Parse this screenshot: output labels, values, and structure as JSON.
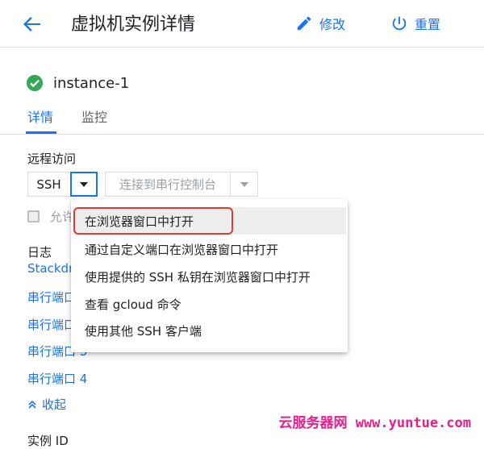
{
  "header": {
    "title": "虚拟机实例详情",
    "edit_label": "修改",
    "reset_label": "重置"
  },
  "instance": {
    "name": "instance-1",
    "status": "running"
  },
  "tabs": [
    {
      "label": "详情",
      "active": true
    },
    {
      "label": "监控",
      "active": false
    }
  ],
  "remote_access": {
    "label": "远程访问",
    "ssh_label": "SSH",
    "serial_label": "连接到串行控制台",
    "checkbox_label": "允许"
  },
  "ssh_menu": {
    "items": [
      "在浏览器窗口中打开",
      "通过自定义端口在浏览器窗口中打开",
      "使用提供的 SSH 私钥在浏览器窗口中打开",
      "查看 gcloud 命令",
      "使用其他 SSH 客户端"
    ]
  },
  "logs": {
    "label": "日志",
    "links": [
      "Stackdri",
      "串行端口",
      "串行端口",
      "串行端口 3",
      "串行端口 4"
    ],
    "collapse_label": "收起"
  },
  "instance_id_label": "实例 ID",
  "watermark": "云服务器网 www.yuntue.com",
  "colors": {
    "accent": "#1a73e8",
    "status_green": "#34a853",
    "highlight_outline": "#e53935"
  }
}
